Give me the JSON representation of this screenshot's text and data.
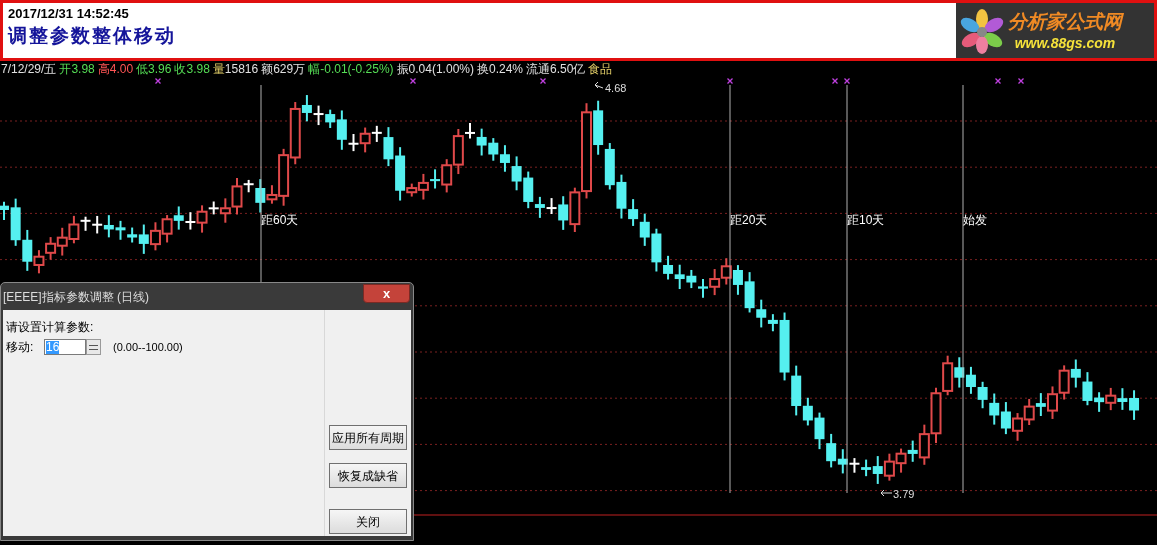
{
  "header": {
    "datetime": "2017/12/31 14:52:45",
    "title": "调整参数整体移动",
    "logo": {
      "name": "分析家公式网",
      "url": "www.88gs.com"
    }
  },
  "quote_bar": [
    {
      "text": "7/12/29/五",
      "kind": "plain"
    },
    {
      "text": "开3.98",
      "kind": "fall"
    },
    {
      "text": "高4.00",
      "kind": "rise"
    },
    {
      "text": "低3.96",
      "kind": "fall"
    },
    {
      "text": "收3.98",
      "kind": "fall"
    },
    {
      "text": "量",
      "kind": "note"
    },
    {
      "text": "15816",
      "kind": "plain"
    },
    {
      "text": "额629万",
      "kind": "plain"
    },
    {
      "text": "幅-0.01(-0.25%)",
      "kind": "fall"
    },
    {
      "text": "振0.04(1.00%)",
      "kind": "plain"
    },
    {
      "text": "换0.24%",
      "kind": "plain"
    },
    {
      "text": "流通6.50亿",
      "kind": "plain"
    },
    {
      "text": "食品",
      "kind": "note"
    }
  ],
  "chart": {
    "markers": [
      {
        "label": "距60天"
      },
      {
        "label": "距20天"
      },
      {
        "label": "距10天"
      },
      {
        "label": "始发"
      }
    ],
    "high_label": "4.68",
    "low_label": "3.79"
  },
  "dialog": {
    "title": "[EEEE]指标参数调整 (日线)",
    "close": "x",
    "prompt": "请设置计算参数:",
    "params": [
      {
        "label": "移动:",
        "value": "16",
        "range": "(0.00--100.00)"
      }
    ],
    "buttons": [
      "应用所有周期",
      "恢复成缺省",
      "关闭"
    ]
  }
}
